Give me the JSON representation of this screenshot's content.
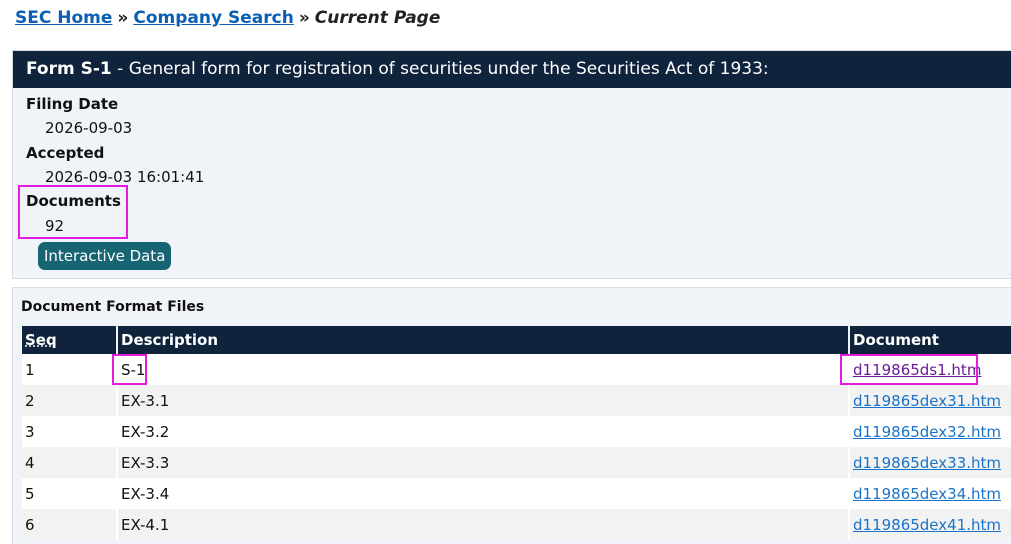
{
  "breadcrumb": {
    "home": "SEC Home",
    "separator": "»",
    "company_search": "Company Search",
    "current": "Current Page"
  },
  "form": {
    "type": "Form S-1",
    "description": " - General form for registration of securities under the Securities Act of 1933:",
    "filing_date_label": "Filing Date",
    "filing_date": "2026-09-03",
    "accepted_label": "Accepted",
    "accepted": "2026-09-03 16:01:41",
    "documents_label": "Documents",
    "documents": "92",
    "interactive_button": "Interactive Data"
  },
  "files": {
    "title": "Document Format Files",
    "headers": {
      "seq": "Seq",
      "description": "Description",
      "document": "Document"
    },
    "rows": [
      {
        "seq": "1",
        "description": "S-1",
        "document": "d119865ds1.htm"
      },
      {
        "seq": "2",
        "description": "EX-3.1",
        "document": "d119865dex31.htm"
      },
      {
        "seq": "3",
        "description": "EX-3.2",
        "document": "d119865dex32.htm"
      },
      {
        "seq": "4",
        "description": "EX-3.3",
        "document": "d119865dex33.htm"
      },
      {
        "seq": "5",
        "description": "EX-3.4",
        "document": "d119865dex34.htm"
      },
      {
        "seq": "6",
        "description": "EX-4.1",
        "document": "d119865dex41.htm"
      }
    ]
  },
  "colors": {
    "header_bg": "#10233d",
    "link": "#1a73c8",
    "visited_link": "#6a1b9a",
    "highlight": "#e21bdc",
    "button_bg": "#176472"
  }
}
